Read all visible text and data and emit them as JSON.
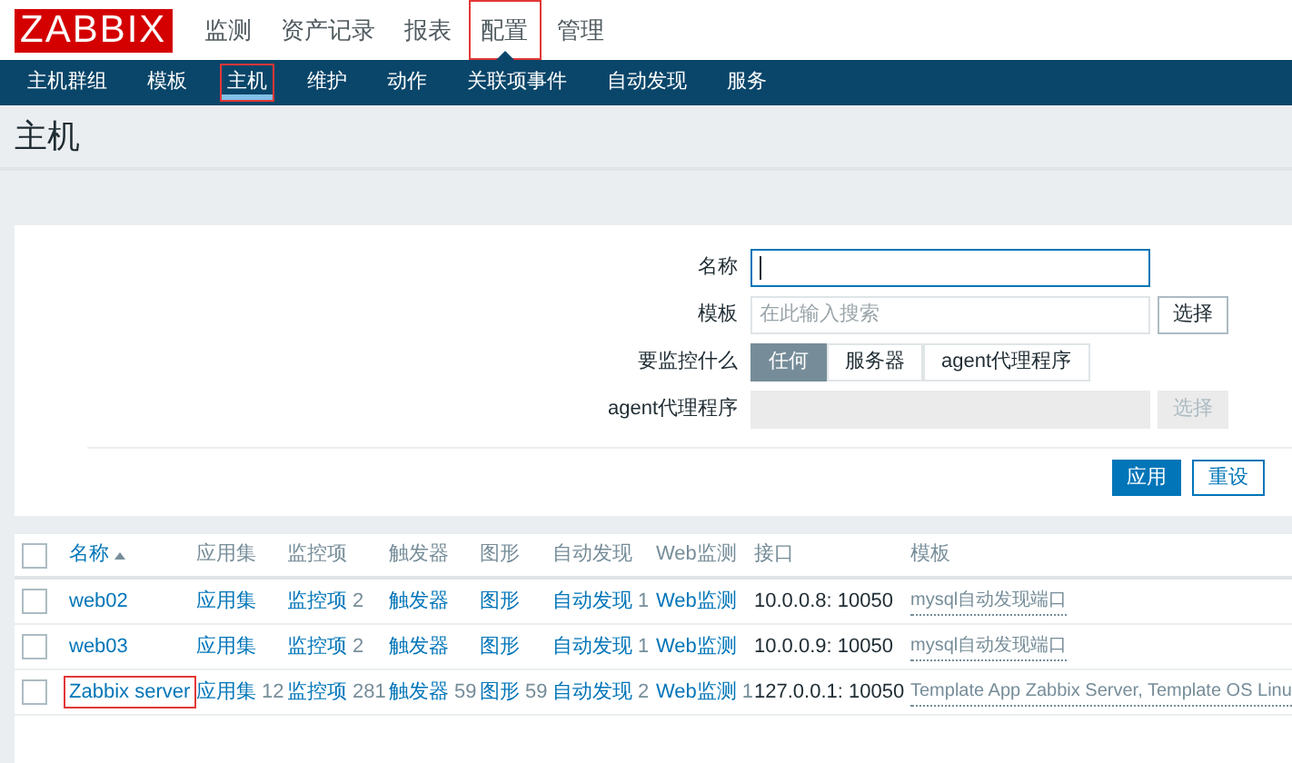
{
  "logo": "ZABBIX",
  "main_menu": [
    {
      "label": "监测",
      "selected": false
    },
    {
      "label": "资产记录",
      "selected": false
    },
    {
      "label": "报表",
      "selected": false
    },
    {
      "label": "配置",
      "selected": true
    },
    {
      "label": "管理",
      "selected": false
    }
  ],
  "sub_menu": [
    {
      "label": "主机群组",
      "selected": false
    },
    {
      "label": "模板",
      "selected": false
    },
    {
      "label": "主机",
      "selected": true
    },
    {
      "label": "维护",
      "selected": false
    },
    {
      "label": "动作",
      "selected": false
    },
    {
      "label": "关联项事件",
      "selected": false
    },
    {
      "label": "自动发现",
      "selected": false
    },
    {
      "label": "服务",
      "selected": false
    }
  ],
  "page_title": "主机",
  "filter": {
    "name": {
      "label": "名称",
      "focused": true
    },
    "template": {
      "label": "模板",
      "placeholder": "在此输入搜索",
      "button": "选择"
    },
    "monitored_by": {
      "label": "要监控什么",
      "options": [
        {
          "label": "任何",
          "selected": true
        },
        {
          "label": "服务器",
          "selected": false
        },
        {
          "label": "agent代理程序",
          "selected": false
        }
      ]
    },
    "proxy": {
      "label": "agent代理程序",
      "button": "选择",
      "disabled": true
    },
    "apply": "应用",
    "reset": "重设"
  },
  "table": {
    "select_all_checked": false,
    "columns": [
      {
        "label": "名称",
        "sorted": true
      },
      {
        "label": "应用集",
        "sorted": false
      },
      {
        "label": "监控项",
        "sorted": false
      },
      {
        "label": "触发器",
        "sorted": false
      },
      {
        "label": "图形",
        "sorted": false
      },
      {
        "label": "自动发现",
        "sorted": false
      },
      {
        "label": "Web监测",
        "sorted": false
      },
      {
        "label": "接口",
        "sorted": false
      },
      {
        "label": "模板",
        "sorted": false
      }
    ],
    "rows": [
      {
        "checked": false,
        "name": "web02",
        "highlighted": false,
        "links": [
          {
            "label": "应用集"
          },
          {
            "label": "监控项",
            "count": "2"
          },
          {
            "label": "触发器"
          },
          {
            "label": "图形"
          },
          {
            "label": "自动发现",
            "count": "1"
          },
          {
            "label": "Web监测"
          }
        ],
        "interface": "10.0.0.8: 10050",
        "templates": "mysql自动发现端口"
      },
      {
        "checked": false,
        "name": "web03",
        "highlighted": false,
        "links": [
          {
            "label": "应用集"
          },
          {
            "label": "监控项",
            "count": "2"
          },
          {
            "label": "触发器"
          },
          {
            "label": "图形"
          },
          {
            "label": "自动发现",
            "count": "1"
          },
          {
            "label": "Web监测"
          }
        ],
        "interface": "10.0.0.9: 10050",
        "templates": "mysql自动发现端口"
      },
      {
        "checked": false,
        "name": "Zabbix server",
        "highlighted": true,
        "links": [
          {
            "label": "应用集",
            "count": "12"
          },
          {
            "label": "监控项",
            "count": "281"
          },
          {
            "label": "触发器",
            "count": "59"
          },
          {
            "label": "图形",
            "count": "59"
          },
          {
            "label": "自动发现",
            "count": "2"
          },
          {
            "label": "Web监测",
            "count": "1"
          }
        ],
        "interface": "127.0.0.1: 10050",
        "templates": "Template App Zabbix Server, Template OS Linu"
      }
    ]
  }
}
